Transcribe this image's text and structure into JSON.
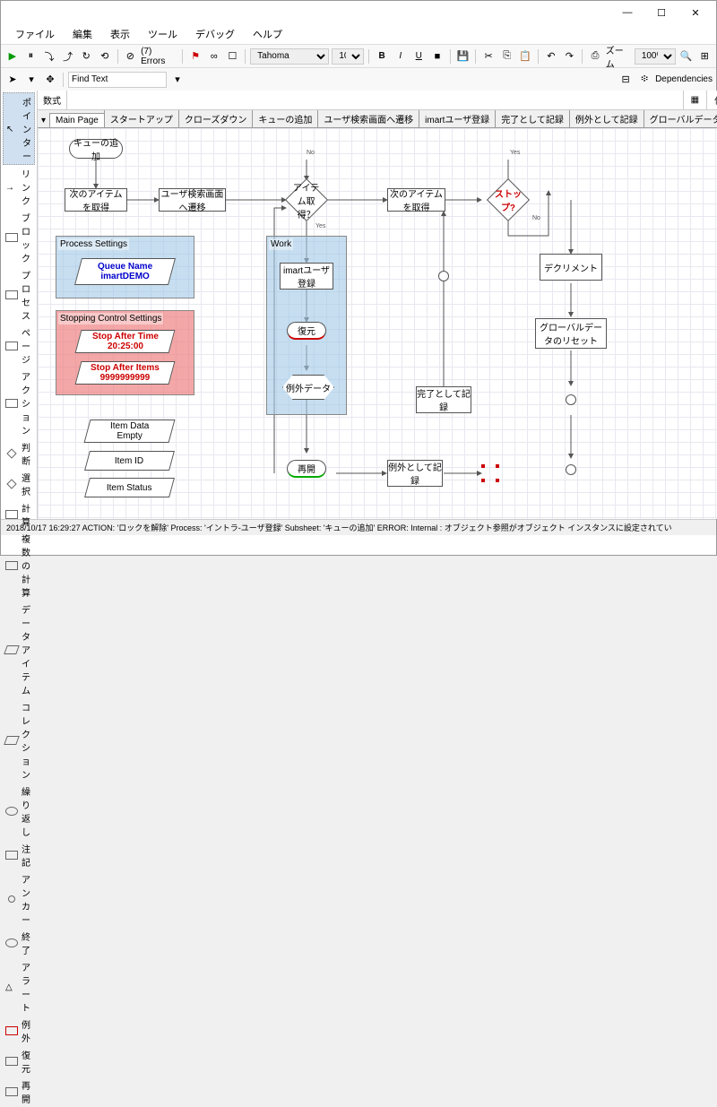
{
  "window": {
    "min": "—",
    "max": "☐",
    "close": "✕"
  },
  "menu": [
    "ファイル",
    "編集",
    "表示",
    "ツール",
    "デバッグ",
    "ヘルプ"
  ],
  "tb1": {
    "errors": "(7) Errors",
    "font": "Tahoma",
    "size": "10",
    "zoom": "ズーム",
    "zoomval": "100%"
  },
  "tb2": {
    "find": "Find Text",
    "dep": "Dependencies"
  },
  "formula": {
    "lbl": "数式",
    "save": "保存先"
  },
  "palette": [
    {
      "l": "ポインター",
      "sel": true
    },
    {
      "l": "リンク"
    },
    {
      "l": "ブロック"
    },
    {
      "l": "プロセス"
    },
    {
      "l": "ページ"
    },
    {
      "l": "アクション"
    },
    {
      "l": "判断"
    },
    {
      "l": "選択"
    },
    {
      "l": "計算"
    },
    {
      "l": "複数の計算"
    },
    {
      "l": "データアイテム"
    },
    {
      "l": "コレクション"
    },
    {
      "l": "繰り返し"
    },
    {
      "l": "注記"
    },
    {
      "l": "アンカー"
    },
    {
      "l": "終了"
    },
    {
      "l": "アラート"
    },
    {
      "l": "例外"
    },
    {
      "l": "復元"
    },
    {
      "l": "再開"
    }
  ],
  "tabs": [
    "Main Page",
    "スタートアップ",
    "クローズダウン",
    "キューの追加",
    "ユーザ検索画面へ遷移",
    "imartユーザ登録",
    "完了として記録",
    "例外として記録",
    "グローバルデータのリセット"
  ],
  "nodes": {
    "queue_add": "キューの追加",
    "next_item1": "次のアイテムを取得",
    "user_search": "ユーザ検索画面へ遷移",
    "item_got": "アイテム取得？",
    "next_item2": "次のアイテムを取得",
    "stop": "ストップ?",
    "ps": "Process Settings",
    "qn": "Queue Name\nimartDEMO",
    "scs": "Stopping Control Settings",
    "sat": "Stop After Time\n20:25:00",
    "sai": "Stop After Items\n9999999999",
    "work": "Work",
    "imart": "imartユーザ登録",
    "restore": "復元",
    "excdata": "例外データ",
    "itemdata": "Item Data\nEmpty",
    "itemid": "Item ID",
    "itemstatus": "Item Status",
    "decrement": "デクリメント",
    "globalreset": "グローバルデータのリセット",
    "complete": "完了として記録",
    "resume": "再開",
    "excrecord": "例外として記録",
    "no": "No",
    "yes": "Yes"
  },
  "status": "2018/10/17 16:29:27 ACTION: 'ロックを解除' Process: 'イントラ-ユーザ登録' Subsheet: 'キューの追加' ERROR: Internal : オブジェクト参照がオブジェクト インスタンスに設定されてい"
}
